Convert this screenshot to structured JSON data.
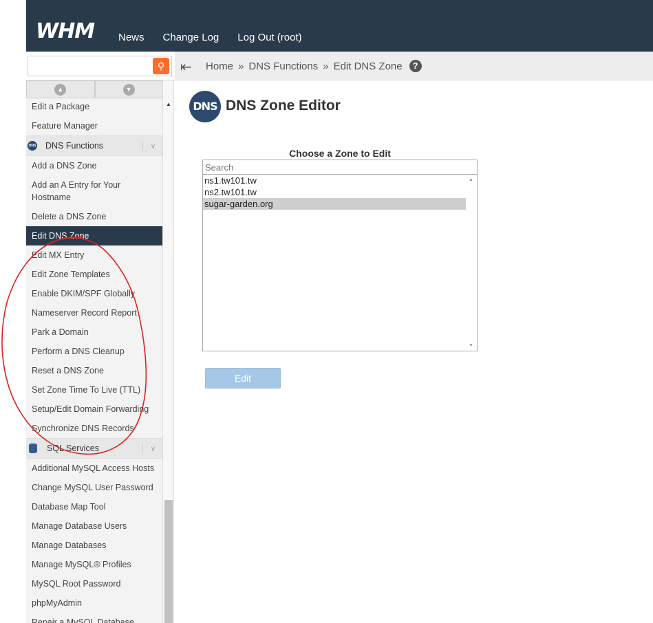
{
  "header": {
    "logo": "WHM",
    "nav": [
      "News",
      "Change Log",
      "Log Out (root)"
    ]
  },
  "search": {
    "value": "",
    "placeholder": ""
  },
  "breadcrumb": {
    "home": "Home",
    "section": "DNS Functions",
    "current": "Edit DNS Zone",
    "sep": "»"
  },
  "sidebar": {
    "items_before": [
      "Edit a Package",
      "Feature Manager"
    ],
    "group_dns": "DNS Functions",
    "dns_items": [
      "Add a DNS Zone",
      "Add an A Entry for Your Hostname",
      "Delete a DNS Zone",
      "Edit DNS Zone",
      "Edit MX Entry",
      "Edit Zone Templates",
      "Enable DKIM/SPF Globally",
      "Nameserver Record Report",
      "Park a Domain",
      "Perform a DNS Cleanup",
      "Reset a DNS Zone",
      "Set Zone Time To Live (TTL)",
      "Setup/Edit Domain Forwarding",
      "Synchronize DNS Records"
    ],
    "group_sql": "SQL Services",
    "sql_items": [
      "Additional MySQL Access Hosts",
      "Change MySQL User Password",
      "Database Map Tool",
      "Manage Database Users",
      "Manage Databases",
      "Manage MySQL® Profiles",
      "MySQL Root Password",
      "phpMyAdmin",
      "Repair a MySQL Database"
    ]
  },
  "main": {
    "icon_text": "DNS",
    "title": "DNS Zone Editor",
    "choose_label": "Choose a Zone to Edit",
    "zone_search_placeholder": "Search",
    "zones": [
      "ns1.tw101.tw",
      "ns2.tw101.tw",
      "sugar-garden.org"
    ],
    "selected_zone": "sugar-garden.org",
    "edit_button": "Edit"
  },
  "colors": {
    "header_bg": "#293a4a",
    "search_button": "#ff6c2c",
    "active_item": "#293a4a",
    "edit_button_disabled": "#a6c8e6",
    "annotation": "#e02020"
  }
}
